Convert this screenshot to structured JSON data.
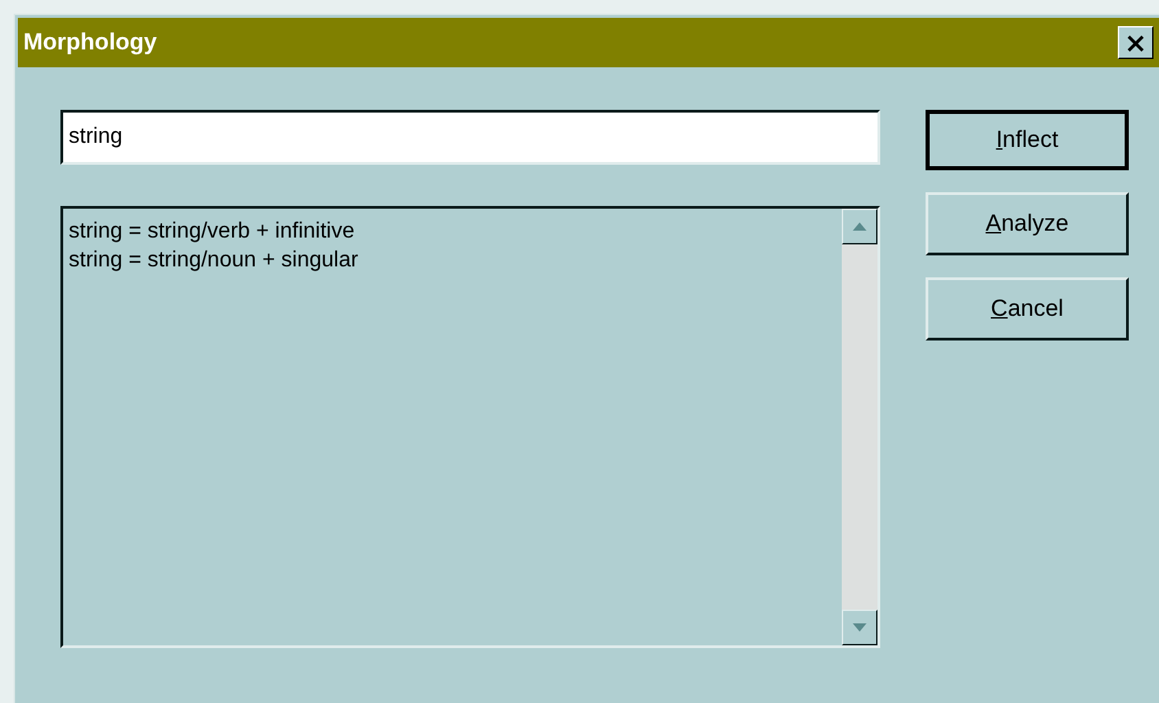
{
  "window": {
    "title": "Morphology",
    "close": "×"
  },
  "word_field": {
    "value": "string"
  },
  "results": [
    "string = string/verb + infinitive",
    "string = string/noun + singular"
  ],
  "buttons": [
    {
      "access_key": "I",
      "label_rest": "nflect",
      "default": true
    },
    {
      "access_key": "A",
      "label_rest": "nalyze",
      "default": false
    },
    {
      "access_key": "C",
      "label_rest": "ancel",
      "default": false
    }
  ]
}
